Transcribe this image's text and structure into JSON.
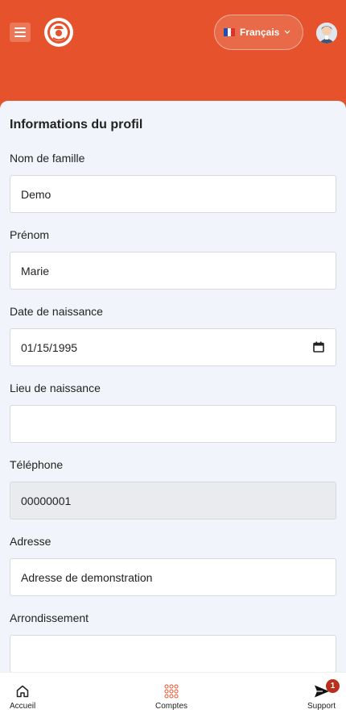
{
  "header": {
    "language": {
      "label": "Français",
      "flag": "fr-flag-icon"
    },
    "menu_icon": "hamburger-menu-icon",
    "logo_icon": "chef-logo-icon",
    "avatar_icon": "user-avatar-icon",
    "accent_color": "#e5522b"
  },
  "profile": {
    "title": "Informations du profil",
    "fields": {
      "last_name": {
        "label": "Nom de famille",
        "value": "Demo"
      },
      "first_name": {
        "label": "Prénom",
        "value": "Marie"
      },
      "birth_date": {
        "label": "Date de naissance",
        "value": "01/15/1995"
      },
      "birth_place": {
        "label": "Lieu de naissance",
        "value": ""
      },
      "phone": {
        "label": "Téléphone",
        "value": "00000001"
      },
      "address": {
        "label": "Adresse",
        "value": "Adresse de demonstration"
      },
      "district": {
        "label": "Arrondissement",
        "value": ""
      }
    }
  },
  "bottom_nav": {
    "home": {
      "label": "Accueil",
      "icon": "home-icon"
    },
    "accounts": {
      "label": "Comptes",
      "icon": "grid-dots-icon"
    },
    "support": {
      "label": "Support",
      "icon": "send-icon",
      "badge": "1"
    }
  }
}
